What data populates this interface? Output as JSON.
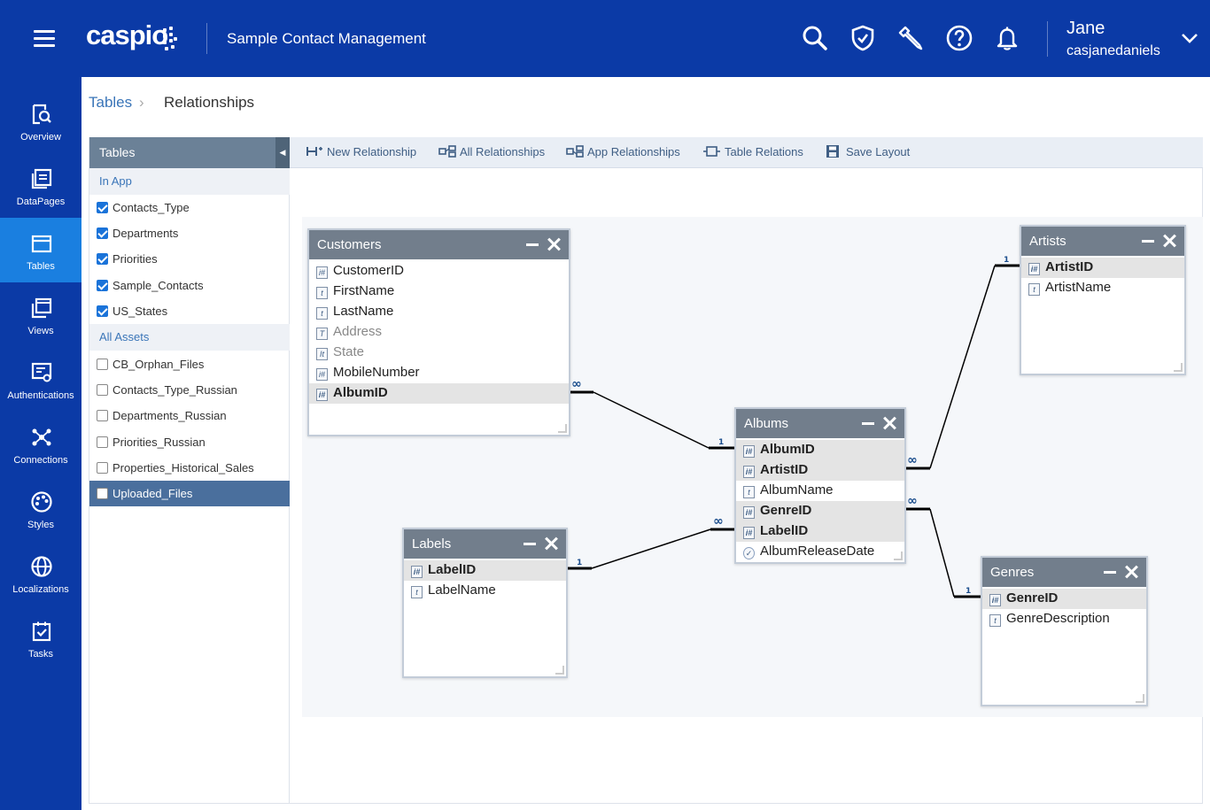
{
  "app": {
    "logo": "caspio",
    "title": "Sample Contact Management"
  },
  "header_icons": [
    "search-icon",
    "shield-check-icon",
    "wrench-icon",
    "help-icon",
    "bell-icon"
  ],
  "user": {
    "name": "Jane",
    "login": "casjanedaniels"
  },
  "nav": [
    {
      "label": "Overview",
      "icon": "overview-icon"
    },
    {
      "label": "DataPages",
      "icon": "datapages-icon"
    },
    {
      "label": "Tables",
      "icon": "tables-icon",
      "active": true
    },
    {
      "label": "Views",
      "icon": "views-icon"
    },
    {
      "label": "Authentications",
      "icon": "authentications-icon"
    },
    {
      "label": "Connections",
      "icon": "connections-icon"
    },
    {
      "label": "Styles",
      "icon": "styles-icon"
    },
    {
      "label": "Localizations",
      "icon": "globe-icon"
    },
    {
      "label": "Tasks",
      "icon": "tasks-icon"
    }
  ],
  "breadcrumb": {
    "parent": "Tables",
    "current": "Relationships"
  },
  "panel": {
    "title": "Tables",
    "collapse_glyph": "◀",
    "in_app_label": "In App",
    "in_app": [
      {
        "name": "Contacts_Type",
        "checked": true
      },
      {
        "name": "Departments",
        "checked": true
      },
      {
        "name": "Priorities",
        "checked": true
      },
      {
        "name": "Sample_Contacts",
        "checked": true
      },
      {
        "name": "US_States",
        "checked": true
      }
    ],
    "all_assets_label": "All Assets",
    "all_assets": [
      {
        "name": "CB_Orphan_Files",
        "checked": false
      },
      {
        "name": "Contacts_Type_Russian",
        "checked": false
      },
      {
        "name": "Departments_Russian",
        "checked": false
      },
      {
        "name": "Priorities_Russian",
        "checked": false
      },
      {
        "name": "Properties_Historical_Sales",
        "checked": false
      },
      {
        "name": "Uploaded_Files",
        "checked": false,
        "selected": true
      }
    ]
  },
  "toolbar": {
    "new_relationship": "New Relationship",
    "all_relationships": "All Relationships",
    "app_relationships": "App Relationships",
    "table_relations": "Table Relations",
    "save_layout": "Save Layout"
  },
  "tables": {
    "customers": {
      "title": "Customers",
      "fields": [
        {
          "name": "CustomerID",
          "icon": "i#",
          "key": false,
          "dim": false
        },
        {
          "name": "FirstName",
          "icon": "t",
          "key": false,
          "dim": false
        },
        {
          "name": "LastName",
          "icon": "t",
          "key": false,
          "dim": false
        },
        {
          "name": "Address",
          "icon": "T",
          "key": false,
          "dim": true
        },
        {
          "name": "State",
          "icon": "It",
          "key": false,
          "dim": true
        },
        {
          "name": "MobileNumber",
          "icon": "i#",
          "key": false,
          "dim": false
        },
        {
          "name": "AlbumID",
          "icon": "i#",
          "key": true,
          "dim": false
        }
      ]
    },
    "artists": {
      "title": "Artists",
      "fields": [
        {
          "name": "ArtistID",
          "icon": "i#",
          "key": true,
          "dim": false
        },
        {
          "name": "ArtistName",
          "icon": "t",
          "key": false,
          "dim": false
        }
      ]
    },
    "albums": {
      "title": "Albums",
      "fields": [
        {
          "name": "AlbumID",
          "icon": "i#",
          "key": true,
          "dim": false
        },
        {
          "name": "ArtistID",
          "icon": "i#",
          "key": true,
          "dim": false
        },
        {
          "name": "AlbumName",
          "icon": "t",
          "key": false,
          "dim": false
        },
        {
          "name": "GenreID",
          "icon": "i#",
          "key": true,
          "dim": false
        },
        {
          "name": "LabelID",
          "icon": "i#",
          "key": true,
          "dim": false
        },
        {
          "name": "AlbumReleaseDate",
          "icon": "✓",
          "key": false,
          "dim": false
        }
      ]
    },
    "labels": {
      "title": "Labels",
      "fields": [
        {
          "name": "LabelID",
          "icon": "i#",
          "key": true,
          "dim": false
        },
        {
          "name": "LabelName",
          "icon": "t",
          "key": false,
          "dim": false
        }
      ]
    },
    "genres": {
      "title": "Genres",
      "fields": [
        {
          "name": "GenreID",
          "icon": "i#",
          "key": true,
          "dim": false
        },
        {
          "name": "GenreDescription",
          "icon": "t",
          "key": false,
          "dim": false
        }
      ]
    }
  },
  "relationships": {
    "one_label": "1",
    "many_glyph": "∞"
  },
  "colors": {
    "brand": "#0b3aa6",
    "nav_active": "#1a7fe0",
    "table_header": "#727e8c",
    "panel_header": "#6b8197",
    "selected_row": "#4a6f9d",
    "link": "#3a75b8"
  }
}
